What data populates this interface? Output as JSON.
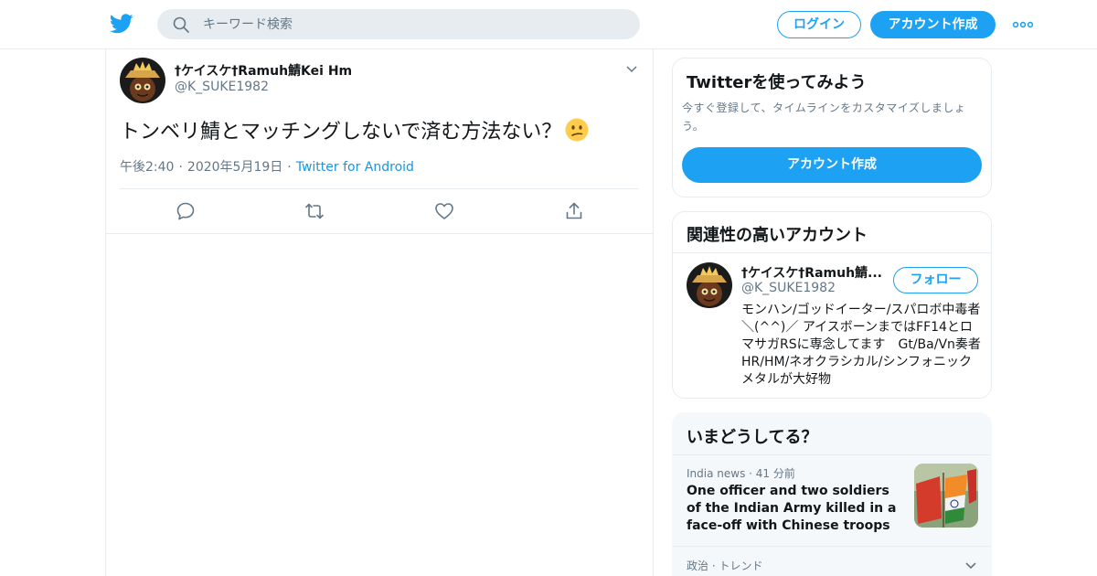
{
  "header": {
    "search_placeholder": "キーワード検索",
    "login_label": "ログイン",
    "signup_label": "アカウント作成",
    "brand_color": "#1da1f2"
  },
  "tweet": {
    "display_name": "†ケイスケ†Ramuh鯖Kei Hm",
    "handle": "@K_SUKE1982",
    "text": "トンベリ鯖とマッチングしないで済む方法ない？",
    "emoji": "confused-face",
    "time": "午後2:40",
    "date": "2020年5月19日",
    "source": "Twitter for Android",
    "actions": [
      "reply-icon",
      "retweet-icon",
      "like-icon",
      "share-icon"
    ]
  },
  "signup_card": {
    "title": "Twitterを使ってみよう",
    "description": "今すぐ登録して、タイムラインをカスタマイズしましょう。",
    "button_label": "アカウント作成"
  },
  "related_card": {
    "title": "関連性の高いアカウント",
    "account": {
      "display_name": "†ケイスケ†Ramuh鯖...",
      "handle": "@K_SUKE1982",
      "follow_label": "フォロー",
      "bio": "モンハン/ゴッドイーター/スパロボ中毒者＼(^^)／ アイスボーンまではFF14とロマサガRSに専念してます　Gt/Ba/Vn奏者　 HR/HM/ネオクラシカル/シンフォニックメタルが大好物"
    }
  },
  "trends_card": {
    "title": "いまどうしてる？",
    "items": [
      {
        "category": "India news",
        "age": "41 分前",
        "headline": "One officer and two soldiers of the Indian Army killed in a face-off with Chinese troops"
      },
      {
        "category": "政治 · トレンド"
      }
    ]
  }
}
